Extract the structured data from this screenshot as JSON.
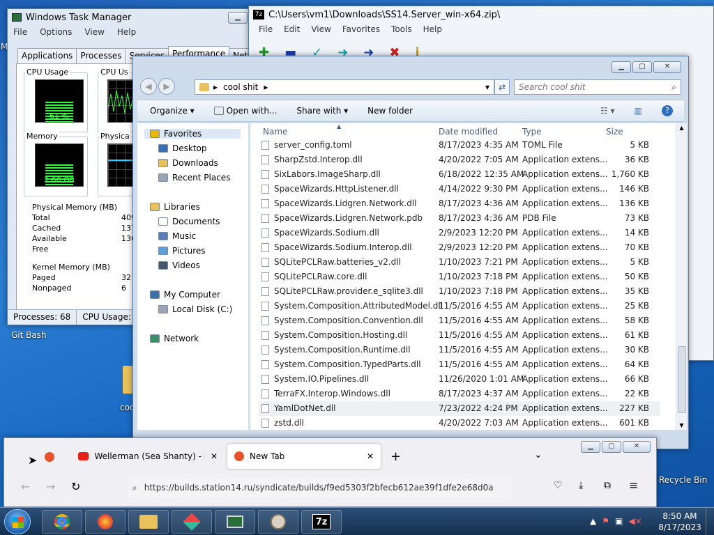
{
  "desktop": {
    "gitbash": "Git Bash",
    "recycle": "Recycle Bin",
    "left_m": "M",
    "coo": "coo"
  },
  "taskmanager": {
    "title": "Windows Task Manager",
    "menu": [
      "File",
      "Options",
      "View",
      "Help"
    ],
    "tabs": [
      "Applications",
      "Processes",
      "Services",
      "Performance",
      "Networking"
    ],
    "cpu_usage_label": "CPU Usage",
    "cpu_history_label": "CPU Us",
    "cpu_value": "61 %",
    "cpu_percent": 61,
    "memory_label": "Memory",
    "phys_history_label": "Physica",
    "memory_value": "2.66 GB",
    "memory_percent": 65,
    "physical_title": "Physical Memory (MB)",
    "physical_rows": [
      {
        "k": "Total",
        "v": "409"
      },
      {
        "k": "Cached",
        "v": "137"
      },
      {
        "k": "Available",
        "v": "136"
      },
      {
        "k": "Free",
        "v": ""
      }
    ],
    "kernel_title": "Kernel Memory (MB)",
    "kernel_rows": [
      {
        "k": "Paged",
        "v": "32"
      },
      {
        "k": "Nonpaged",
        "v": "6"
      }
    ],
    "status_processes": "Processes: 68",
    "status_cpu": "CPU Usage:"
  },
  "sevenzip": {
    "title": "C:\\Users\\vm1\\Downloads\\SS14.Server_win-x64.zip\\",
    "menu": [
      "File",
      "Edit",
      "View",
      "Favorites",
      "Tools",
      "Help"
    ]
  },
  "explorer": {
    "breadcrumb": "cool shit",
    "search_placeholder": "Search cool shit",
    "commands": [
      "Organize",
      "Open with...",
      "Share with",
      "New folder"
    ],
    "nav": [
      {
        "label": "Favorites",
        "group": true
      },
      {
        "label": "Desktop"
      },
      {
        "label": "Downloads"
      },
      {
        "label": "Recent Places"
      },
      {
        "label": "Libraries",
        "group": true
      },
      {
        "label": "Documents"
      },
      {
        "label": "Music"
      },
      {
        "label": "Pictures"
      },
      {
        "label": "Videos"
      },
      {
        "label": "My Computer",
        "group": true
      },
      {
        "label": "Local Disk (C:)"
      },
      {
        "label": "Network",
        "group": true
      }
    ],
    "columns": [
      "Name",
      "Date modified",
      "Type",
      "Size"
    ],
    "files": [
      {
        "name": "server_config.toml",
        "date": "8/17/2023 4:35 AM",
        "type": "TOML File",
        "size": "5 KB"
      },
      {
        "name": "SharpZstd.Interop.dll",
        "date": "4/20/2022 7:05 AM",
        "type": "Application extens...",
        "size": "36 KB"
      },
      {
        "name": "SixLabors.ImageSharp.dll",
        "date": "6/18/2022 12:35 AM",
        "type": "Application extens...",
        "size": "1,760 KB"
      },
      {
        "name": "SpaceWizards.HttpListener.dll",
        "date": "4/14/2022 9:30 PM",
        "type": "Application extens...",
        "size": "146 KB"
      },
      {
        "name": "SpaceWizards.Lidgren.Network.dll",
        "date": "8/17/2023 4:36 AM",
        "type": "Application extens...",
        "size": "136 KB"
      },
      {
        "name": "SpaceWizards.Lidgren.Network.pdb",
        "date": "8/17/2023 4:36 AM",
        "type": "PDB File",
        "size": "73 KB"
      },
      {
        "name": "SpaceWizards.Sodium.dll",
        "date": "2/9/2023 12:20 PM",
        "type": "Application extens...",
        "size": "14 KB"
      },
      {
        "name": "SpaceWizards.Sodium.Interop.dll",
        "date": "2/9/2023 12:20 PM",
        "type": "Application extens...",
        "size": "70 KB"
      },
      {
        "name": "SQLitePCLRaw.batteries_v2.dll",
        "date": "1/10/2023 7:21 PM",
        "type": "Application extens...",
        "size": "5 KB"
      },
      {
        "name": "SQLitePCLRaw.core.dll",
        "date": "1/10/2023 7:18 PM",
        "type": "Application extens...",
        "size": "50 KB"
      },
      {
        "name": "SQLitePCLRaw.provider.e_sqlite3.dll",
        "date": "1/10/2023 7:18 PM",
        "type": "Application extens...",
        "size": "35 KB"
      },
      {
        "name": "System.Composition.AttributedModel.dll",
        "date": "11/5/2016 4:55 AM",
        "type": "Application extens...",
        "size": "25 KB"
      },
      {
        "name": "System.Composition.Convention.dll",
        "date": "11/5/2016 4:55 AM",
        "type": "Application extens...",
        "size": "58 KB"
      },
      {
        "name": "System.Composition.Hosting.dll",
        "date": "11/5/2016 4:55 AM",
        "type": "Application extens...",
        "size": "61 KB"
      },
      {
        "name": "System.Composition.Runtime.dll",
        "date": "11/5/2016 4:55 AM",
        "type": "Application extens...",
        "size": "30 KB"
      },
      {
        "name": "System.Composition.TypedParts.dll",
        "date": "11/5/2016 4:55 AM",
        "type": "Application extens...",
        "size": "64 KB"
      },
      {
        "name": "System.IO.Pipelines.dll",
        "date": "11/26/2020 1:01 AM",
        "type": "Application extens...",
        "size": "66 KB"
      },
      {
        "name": "TerraFX.Interop.Windows.dll",
        "date": "8/17/2023 4:37 AM",
        "type": "Application extens...",
        "size": "22 KB"
      },
      {
        "name": "YamlDotNet.dll",
        "date": "7/23/2022 4:24 PM",
        "type": "Application extens...",
        "size": "227 KB",
        "selected": true
      },
      {
        "name": "zstd.dll",
        "date": "4/20/2022 7:03 AM",
        "type": "Application extens...",
        "size": "601 KB"
      }
    ]
  },
  "firefox": {
    "tab1_title": "Wellerman (Sea Shanty) - Euger",
    "tab2_title": "New Tab",
    "url": "https://builds.station14.ru/syndicate/builds/f9ed5303f2bfecb612ae39f1dfe2e68d0a"
  },
  "tray": {
    "time": "8:50 AM",
    "date": "8/17/2023"
  }
}
